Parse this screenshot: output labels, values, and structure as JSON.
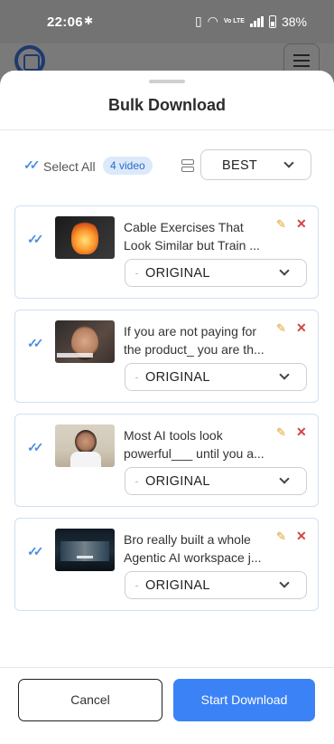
{
  "status_bar": {
    "time": "22:06",
    "battery": "38%",
    "network": "Vo LTE"
  },
  "sheet": {
    "title": "Bulk Download"
  },
  "toolbar": {
    "select_all_label": "Select All",
    "count_badge": "4 video",
    "quality_value": "BEST"
  },
  "videos": [
    {
      "title": "Cable Exercises That Look Similar but Train ...",
      "quality": "ORIGINAL"
    },
    {
      "title": "If you are not paying for the product_ you are th...",
      "quality": "ORIGINAL"
    },
    {
      "title": "Most AI tools look powerful___ until you a...",
      "quality": "ORIGINAL"
    },
    {
      "title": "Bro really built a whole Agentic AI workspace j...",
      "quality": "ORIGINAL"
    }
  ],
  "footer": {
    "cancel_label": "Cancel",
    "start_label": "Start Download"
  },
  "colors": {
    "accent": "#3b82f6",
    "check": "#4a8ee0",
    "edit": "#e0a224",
    "delete": "#d04545"
  },
  "icons": {
    "check": "double-check-icon",
    "edit": "pencil-icon",
    "delete": "close-icon",
    "layers": "layers-icon",
    "chevron": "chevron-down-icon"
  }
}
